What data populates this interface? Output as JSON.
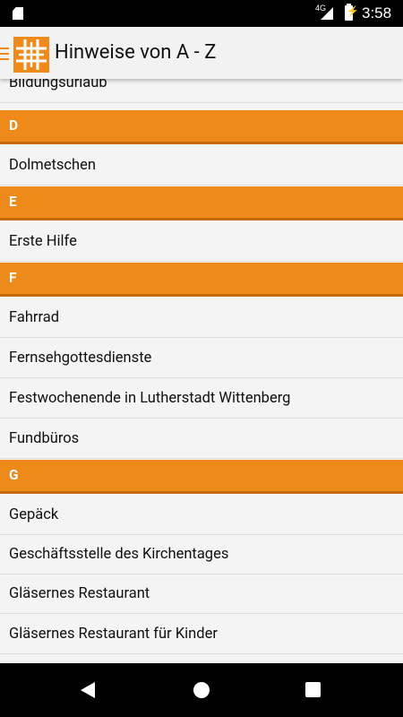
{
  "status_bar": {
    "time": "3:58",
    "network": "4G"
  },
  "app_bar": {
    "title": "Hinweise von A - Z"
  },
  "list": {
    "partial_item": "Bildungsurlaub",
    "sections": [
      {
        "letter": "D",
        "items": [
          "Dolmetschen"
        ]
      },
      {
        "letter": "E",
        "items": [
          "Erste Hilfe"
        ]
      },
      {
        "letter": "F",
        "items": [
          "Fahrrad",
          "Fernsehgottesdienste",
          "Festwochenende in Lutherstadt Wittenberg",
          "Fundbüros"
        ]
      },
      {
        "letter": "G",
        "items": [
          "Gepäck",
          "Geschäftsstelle des Kirchentages",
          "Gläsernes Restaurant",
          "Gläsernes Restaurant für Kinder"
        ]
      }
    ]
  },
  "colors": {
    "accent": "#ee8a1a",
    "accent_dark": "#c46a0b",
    "background": "#f4f4f4"
  }
}
